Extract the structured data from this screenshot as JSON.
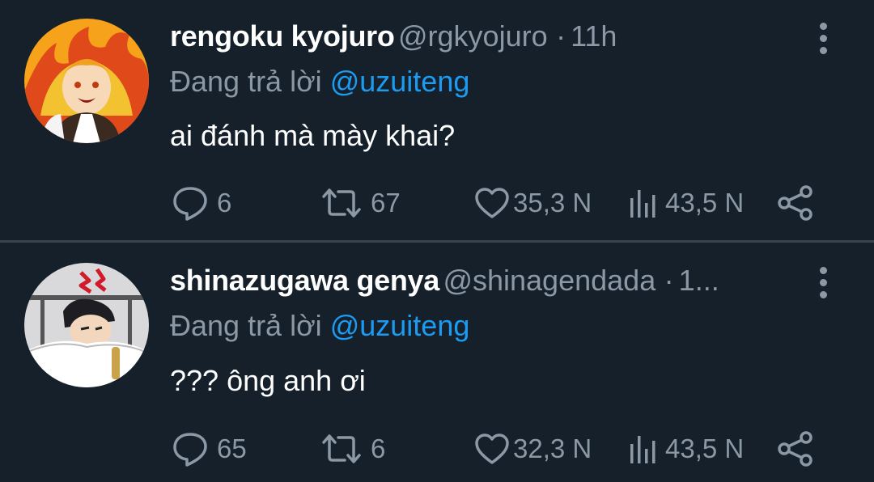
{
  "tweets": [
    {
      "display_name": "rengoku kyojuro",
      "handle": "@rgkyojuro",
      "separator": "·",
      "time": "11h",
      "reply_prefix": "Đang trả lời",
      "reply_to": "@uzuiteng",
      "text": "ai đánh mà mày khai?",
      "replies": "6",
      "retweets": "67",
      "likes": "35,3 N",
      "views": "43,5 N",
      "avatar_icon": "flame-haired-character-avatar",
      "colors": {
        "avatar_bg": "#f6a21a"
      }
    },
    {
      "display_name": "shinazugawa genya",
      "handle": "@shinagendada",
      "separator": "·",
      "time": "1...",
      "reply_prefix": "Đang trả lời",
      "reply_to": "@uzuiteng",
      "text": "??? ông anh ơi",
      "replies": "65",
      "retweets": "6",
      "likes": "32,3 N",
      "views": "43,5 N",
      "avatar_icon": "sleeping-character-avatar",
      "colors": {
        "avatar_bg": "#d9d9dc"
      }
    }
  ],
  "colors": {
    "background": "#15202b",
    "muted_text": "#8b98a5",
    "mention": "#1d9bf0",
    "divider": "#38444d"
  }
}
